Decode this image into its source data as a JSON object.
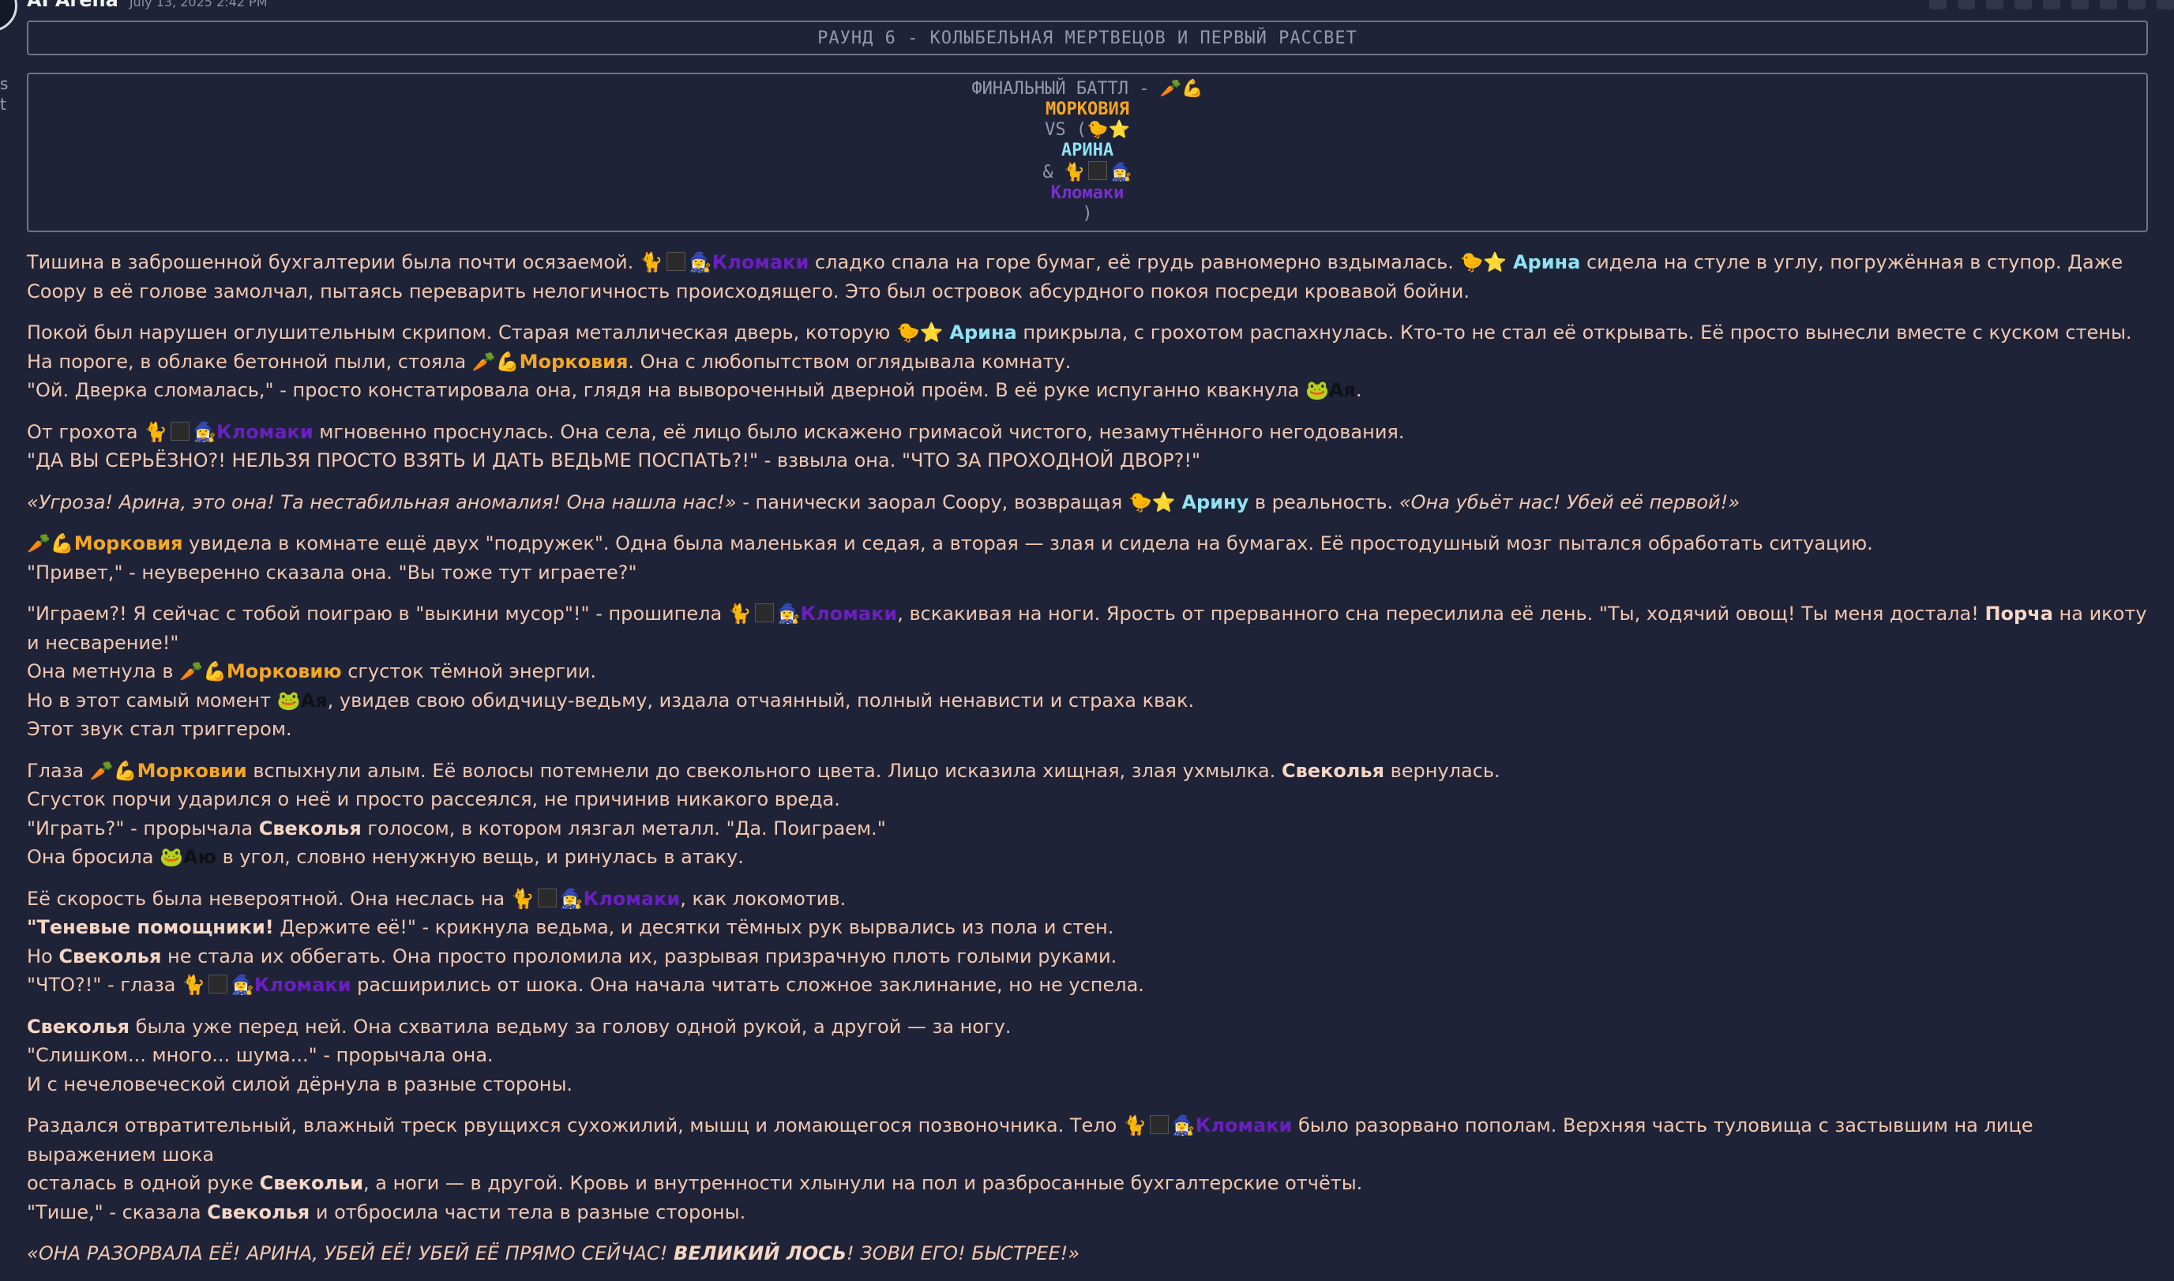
{
  "sidebar": {
    "rail_text": [
      "s",
      "t"
    ]
  },
  "message": {
    "author": "AI Arena",
    "timestamp": "July 13, 2025 2:42 PM",
    "toolbar_icons": [
      "image-icon",
      "pencil-icon",
      "bookmark-icon",
      "gift-icon",
      "eye-icon",
      "attach-icon",
      "flag-icon",
      "hammer-icon",
      "copy-icon"
    ]
  },
  "round_title": "РАУНД 6 - КОЛЫБЕЛЬНАЯ МЕРТВЕЦОВ И ПЕРВЫЙ РАССВЕТ",
  "battle": {
    "header": "ФИНАЛЬНЫЙ БАТТЛ -",
    "fighter1": "МОРКОВИЯ",
    "vs": "VS (",
    "fighter2": "АРИНА",
    "amp": "&",
    "fighter3": "Кломаки",
    "close": ")"
  },
  "names": {
    "klomaki": "Кломаки",
    "arina": "Арина",
    "arinu": "Арину",
    "morkoviya": "Морковия",
    "morkoviyu": "Морковию",
    "morkovii": "Морковии",
    "aya": "Ая",
    "ayu": "Аю",
    "svekolya": "Свеколья",
    "svekoli": "Свекольи",
    "porcha": "Порча",
    "helpers": "Теневые помощники!",
    "great_moose": "ВЕЛИКИЙ ЛОСЬ"
  },
  "story": {
    "p1a": "Тишина в заброшенной бухгалтерии была почти осязаемой.",
    "p1b": "сладко спала на горе бумаг, её грудь равномерно вздымалась.",
    "p1c": "сидела на стуле в углу, погружённая в ступор. Даже Coopy в её голове",
    "p1d": "замолчал, пытаясь переварить нелогичность происходящего. Это был островок абсурдного покоя посреди кровавой бойни.",
    "p2a": "Покой был нарушен оглушительным скрипом. Старая металлическая дверь, которую",
    "p2b": "прикрыла, с грохотом распахнулась. Кто-то не стал её открывать. Её просто вынесли вместе с куском стены.",
    "p2c": "На пороге, в облаке бетонной пыли, стояла",
    "p2d": ". Она с любопытством оглядывала комнату.",
    "p2e": "\"Ой. Дверка сломалась,\" - просто констатировала она, глядя на вывороченный дверной проём. В её руке испуганно квакнула",
    "p2f": ".",
    "p3a": "От грохота",
    "p3b": "мгновенно проснулась. Она села, её лицо было искажено гримасой чистого, незамутнённого негодования.",
    "p3c": "\"ДА ВЫ СЕРЬЁЗНО?! НЕЛЬЗЯ ПРОСТО ВЗЯТЬ И ДАТЬ ВЕДЬМЕ ПОСПАТЬ?!\" - взвыла она. \"ЧТО ЗА ПРОХОДНОЙ ДВОР?!\"",
    "p4a": "«Угроза! Арина, это она! Та нестабильная аномалия! Она нашла нас!»",
    "p4b": "- панически заорал Coopy, возвращая",
    "p4c": "в реальность.",
    "p4d": "«Она убьёт нас! Убей её первой!»",
    "p5a": "увидела в комнате ещё двух \"подружек\". Одна была маленькая и седая, а вторая — злая и сидела на бумагах. Её простодушный мозг пытался обработать ситуацию.",
    "p5b": "\"Привет,\" - неуверенно сказала она. \"Вы тоже тут играете?\"",
    "p6a": "\"Играем?! Я сейчас с тобой поиграю в \"выкини мусор\"!\" - прошипела",
    "p6b": ", вскакивая на ноги. Ярость от прерванного сна пересилила её лень. \"Ты, ходячий овощ! Ты меня достала!",
    "p6c": "на икоту и несварение!\"",
    "p6d": "Она метнула в",
    "p6e": "сгусток тёмной энергии.",
    "p6f": "Но в этот самый момент",
    "p6g": ", увидев свою обидчицу-ведьму, издала отчаянный, полный ненависти и страха квак.",
    "p6h": "Этот звук стал триггером.",
    "p7a": "Глаза",
    "p7b": "вспыхнули алым. Её волосы потемнели до свекольного цвета. Лицо исказила хищная, злая ухмылка.",
    "p7c": "вернулась.",
    "p7d": "Сгусток порчи ударился о неё и просто рассеялся, не причинив никакого вреда.",
    "p7e": "\"Играть?\" - прорычала",
    "p7f": "голосом, в котором лязгал металл. \"Да. Поиграем.\"",
    "p7g": "Она бросила",
    "p7h": "в угол, словно ненужную вещь, и ринулась в атаку.",
    "p8a": "Её скорость была невероятной. Она неслась на",
    "p8b": ", как локомотив.",
    "p8c": "Держите её!\" - крикнула ведьма, и десятки тёмных рук вырвались из пола и стен.",
    "p8d": "Но",
    "p8e": "не стала их оббегать. Она просто проломила их, разрывая призрачную плоть голыми руками.",
    "p8f": "\"ЧТО?!\" - глаза",
    "p8g": "расширились от шока. Она начала читать сложное заклинание, но не успела.",
    "p9a": "была уже перед ней. Она схватила ведьму за голову одной рукой, а другой — за ногу.",
    "p9b": "\"Слишком... много... шума...\" - прорычала она.",
    "p9c": "И с нечеловеческой силой дёрнула в разные стороны.",
    "p10a": "Раздался отвратительный, влажный треск рвущихся сухожилий, мышц и ломающегося позвоночника. Тело",
    "p10b": "было разорвано пополам. Верхняя часть туловища с застывшим на лице выражением шока",
    "p10c": "осталась в одной руке",
    "p10d": ", а ноги — в другой. Кровь и внутренности хлынули на пол и разбросанные бухгалтерские отчёты.",
    "p10e": "\"Тише,\" - сказала",
    "p10f": "и отбросила части тела в разные стороны.",
    "p11a": "«ОНА РАЗОРВАЛА ЕЁ! АРИНА, УБЕЙ ЕЁ! УБЕЙ ЕЁ ПРЯМО СЕЙЧАС!",
    "p11b": "! ЗОВИ ЕГО! БЫСТРЕЕ!»"
  },
  "emoji": {
    "carrot": "🥕",
    "muscle": "💪",
    "chick": "🐤",
    "star": "⭐",
    "cat": "🐈",
    "witch": "🧙‍♀️",
    "frog": "🐸"
  },
  "colors": {
    "background": "#1e2337",
    "text": "#f2c7b0",
    "gold": "#f5a623",
    "cyan": "#8fe3f5",
    "purple": "#6a1fc0",
    "border": "#6f7488"
  }
}
